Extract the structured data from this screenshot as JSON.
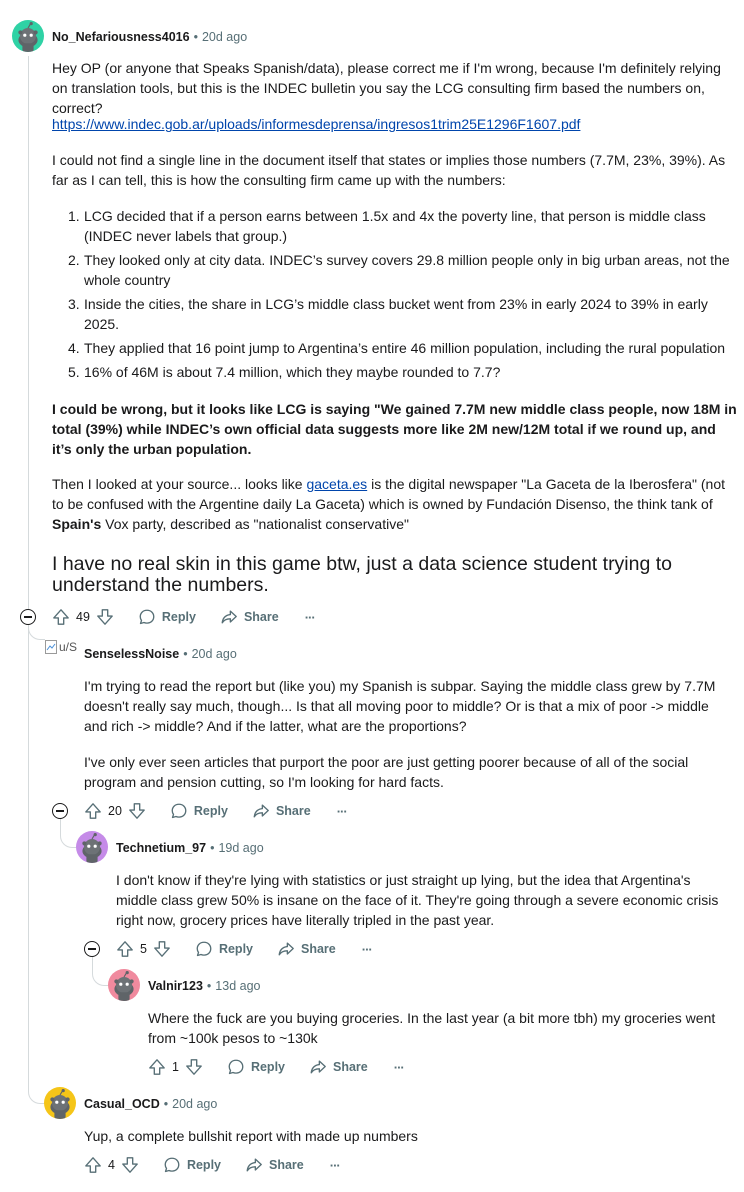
{
  "comments": [
    {
      "username": "No_Nefariousness4016",
      "time": "20d ago",
      "avatar_color": "#2fd2a5",
      "paragraphs": [
        "Hey OP (or anyone that Speaks Spanish/data), please correct me if I'm wrong, because I'm definitely relying on translation tools, but this is the INDEC bulletin you say the LCG consulting firm based the numbers on, correct?",
        "I could not find a single line in the document itself that states or implies those numbers (7.7M, 23%, 39%). As far as I can tell, this is how the consulting firm came up with the numbers:"
      ],
      "link": "https://www.indec.gob.ar/uploads/informesdeprensa/ingresos1trim25E1296F1607.pdf",
      "list": [
        "LCG decided that if a person earns between 1.5x and 4x the poverty line, that person is middle class (INDEC never labels that group.)",
        "They looked only at city data. INDEC’s survey covers 29.8 million people only in big urban areas, not the whole country",
        "Inside the cities, the share in LCG’s middle class bucket went from 23% in early 2024 to 39% in early 2025.",
        "They applied that 16 point jump to Argentina’s entire 46 million population, including the rural population",
        "16% of 46M is about 7.4 million, which they maybe rounded to 7.7?"
      ],
      "list_numbers": [
        "1.",
        "2.",
        "3.",
        "4.",
        "5."
      ],
      "bold_paragraph": "I could be wrong, but it looks like LCG is saying \"We gained 7.7M new middle class people, now 18M in total (39%) while INDEC’s own official data suggests more like 2M new/12M total if we round up, and it’s only the urban population.",
      "source_paragraph": {
        "before_link": "Then I looked at your source... looks like ",
        "link_text": "gaceta.es",
        "after_link": " is the digital newspaper \"La Gaceta de la Iberosfera\" (not to be confused with the Argentine daily La Gaceta) which is owned by Fundación Disenso, the think tank of ",
        "bold": "Spain's",
        "end": " Vox party, described as \"nationalist conservative\""
      },
      "large_text": "I have no real skin in this game btw, just a data science student trying to understand the numbers.",
      "votes": "49",
      "reply_label": "Reply",
      "share_label": "Share",
      "more_label": "···"
    },
    {
      "username": "SenselessNoise",
      "time": "20d ago",
      "avatar_alt": "u/S",
      "paragraphs": [
        "I'm trying to read the report but (like you) my Spanish is subpar. Saying the middle class grew by 7.7M doesn't really say much, though... Is that all moving poor to middle? Or is that a mix of poor -> middle and rich -> middle? And if the latter, what are the proportions?",
        "I've only ever seen articles that purport the poor are just getting poorer because of all of the social program and pension cutting, so I'm looking for hard facts."
      ],
      "votes": "20",
      "reply_label": "Reply",
      "share_label": "Share",
      "more_label": "···"
    },
    {
      "username": "Technetium_97",
      "time": "19d ago",
      "avatar_color": "#c58be8",
      "paragraphs": [
        "I don't know if they're lying with statistics or just straight up lying, but the idea that Argentina's middle class grew 50% is insane on the face of it. They're going through a severe economic crisis right now, grocery prices have literally tripled in the past year."
      ],
      "votes": "5",
      "reply_label": "Reply",
      "share_label": "Share",
      "more_label": "···"
    },
    {
      "username": "Valnir123",
      "time": "13d ago",
      "avatar_color": "#f08a9e",
      "paragraphs": [
        "Where the fuck are you buying groceries. In the last year (a bit more tbh) my groceries went from ~100k pesos to ~130k"
      ],
      "votes": "1",
      "reply_label": "Reply",
      "share_label": "Share",
      "more_label": "···"
    },
    {
      "username": "Casual_OCD",
      "time": "20d ago",
      "avatar_color": "#f5c518",
      "paragraphs": [
        "Yup, a complete bullshit report with made up numbers"
      ],
      "votes": "4",
      "reply_label": "Reply",
      "share_label": "Share",
      "more_label": "···"
    }
  ]
}
